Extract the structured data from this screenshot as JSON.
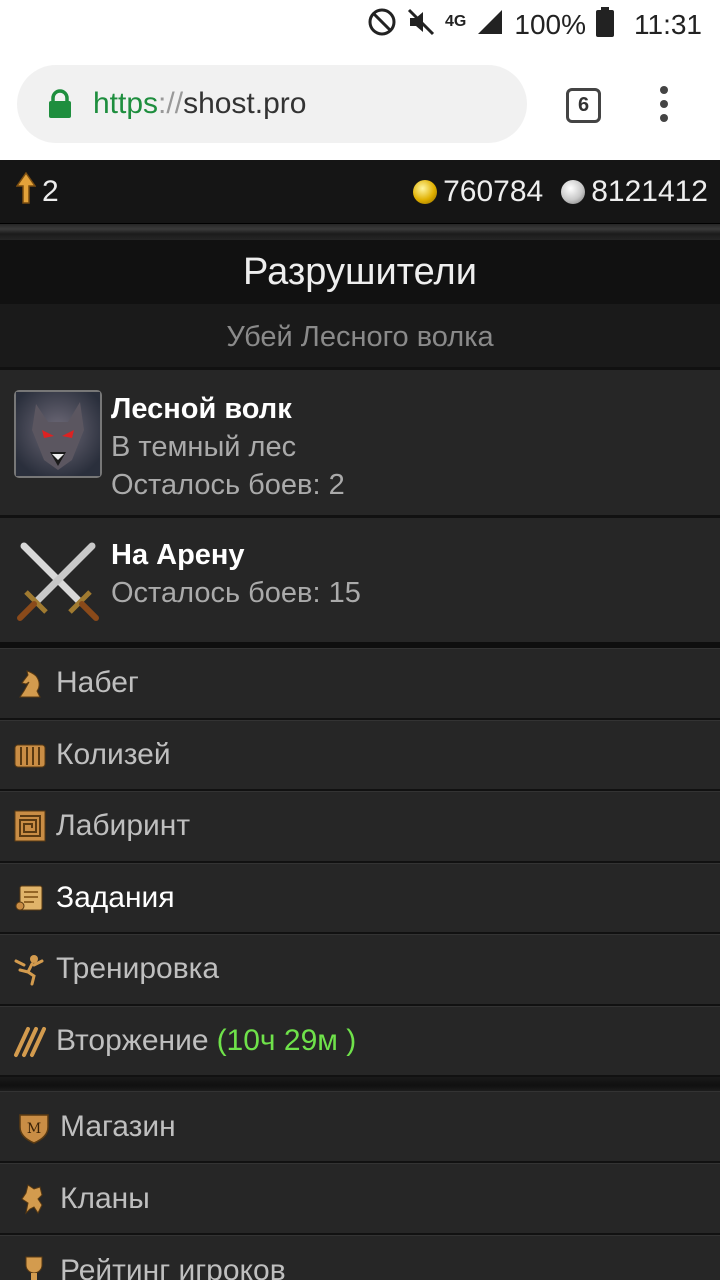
{
  "status_bar": {
    "battery": "100%",
    "time": "11:31",
    "network": "4G",
    "icons": [
      "no-disturb-icon",
      "mute-icon",
      "signal-icon",
      "battery-icon"
    ]
  },
  "browser": {
    "url_scheme": "https",
    "url_sep": "://",
    "url_host": "shost.pro",
    "tab_count": "6",
    "colors": {
      "secure": "#1e8e3e"
    }
  },
  "game": {
    "level": "2",
    "gold": "760784",
    "silver": "8121412",
    "title": "Разрушители",
    "subtitle": "Убей Лесного волка",
    "quests": [
      {
        "name": "Лесной волк",
        "line1": "В темный лес",
        "line2": "Осталось боев: 2",
        "icon": "wolf-portrait"
      },
      {
        "name": "На Арену",
        "line1": "Осталось боев: 15",
        "icon": "crossed-swords-icon"
      }
    ],
    "menu": [
      {
        "label": "Набег",
        "icon": "knight-icon"
      },
      {
        "label": "Колизей",
        "icon": "colosseum-icon"
      },
      {
        "label": "Лабиринт",
        "icon": "labyrinth-icon"
      },
      {
        "label": "Задания",
        "icon": "scroll-icon"
      },
      {
        "label": "Тренировка",
        "icon": "training-icon"
      },
      {
        "label": "Вторжение",
        "icon": "invasion-icon",
        "timer": "(10ч 29м )"
      }
    ],
    "menu2": [
      {
        "label": "Магазин",
        "icon": "shop-shield-icon"
      },
      {
        "label": "Кланы",
        "icon": "lion-icon"
      },
      {
        "label": "Рейтинг игроков",
        "icon": "trophy-icon"
      }
    ],
    "colors": {
      "timer": "#6fe24a",
      "bg": "#262626"
    }
  }
}
